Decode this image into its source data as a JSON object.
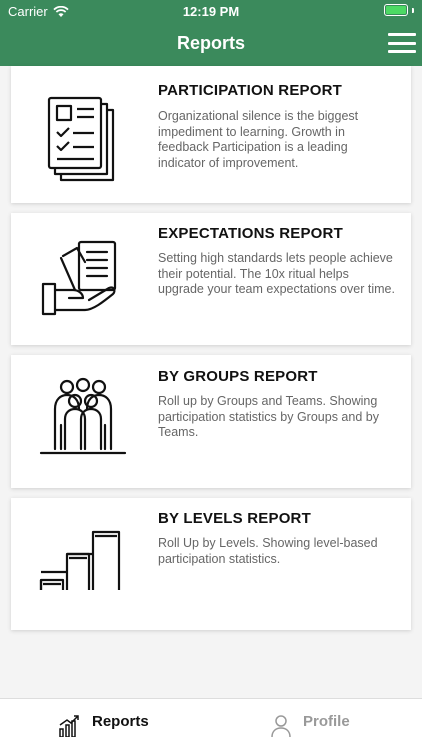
{
  "status": {
    "carrier": "Carrier",
    "time": "12:19 PM"
  },
  "nav": {
    "title": "Reports"
  },
  "cards": [
    {
      "title": "PARTICIPATION REPORT",
      "desc": "Organizational silence is the biggest impediment to learning. Growth in feedback Participation is a leading indicator of improvement.",
      "icon": "report-documents-icon"
    },
    {
      "title": "EXPECTATIONS REPORT",
      "desc": "Setting high standards lets people achieve their potential. The 10x ritual helps upgrade your team expectations over time.",
      "icon": "hand-holding-documents-icon"
    },
    {
      "title": "BY GROUPS REPORT",
      "desc": "Roll up by Groups and Teams. Showing participation statistics by Groups and by Teams.",
      "icon": "people-group-icon"
    },
    {
      "title": "BY LEVELS REPORT",
      "desc": "Roll Up by Levels. Showing level-based participation statistics.",
      "icon": "levels-steps-icon"
    }
  ],
  "tabbar": {
    "reports_label": "Reports",
    "profile_label": "Profile"
  },
  "colors": {
    "header": "#3b8a5c",
    "battery": "#4cd964"
  }
}
